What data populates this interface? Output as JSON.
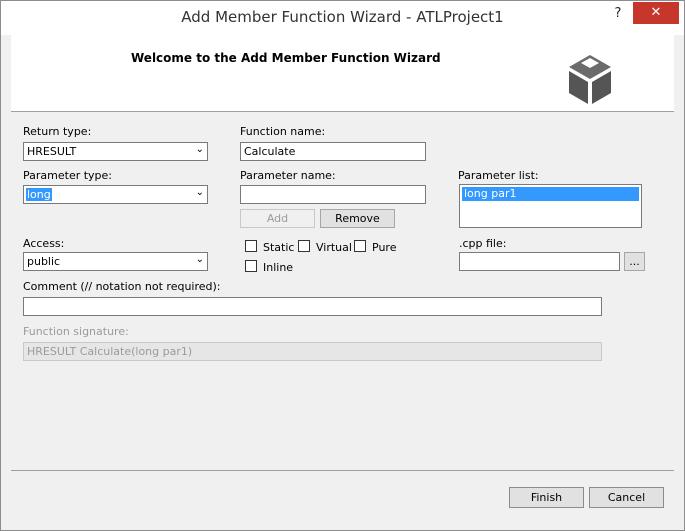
{
  "window": {
    "title": "Add Member Function Wizard - ATLProject1",
    "help": "?",
    "close": "✕"
  },
  "header": {
    "title": "Welcome to the Add Member Function Wizard"
  },
  "form": {
    "return_type": {
      "label": "Return type:",
      "value": "HRESULT"
    },
    "function_name": {
      "label": "Function name:",
      "value": "Calculate"
    },
    "parameter_type": {
      "label": "Parameter type:",
      "value": "long"
    },
    "parameter_name": {
      "label": "Parameter name:",
      "value": ""
    },
    "parameter_list": {
      "label": "Parameter list:",
      "items": [
        "long par1"
      ]
    },
    "add_label": "Add",
    "remove_label": "Remove",
    "access": {
      "label": "Access:",
      "value": "public"
    },
    "options": {
      "static": "Static",
      "virtual": "Virtual",
      "pure": "Pure",
      "inline": "Inline"
    },
    "cpp_file": {
      "label": ".cpp file:",
      "value": "",
      "browse": "..."
    },
    "comment": {
      "label": "Comment (// notation not required):",
      "value": ""
    },
    "signature": {
      "label": "Function signature:",
      "value": "HRESULT Calculate(long par1)"
    }
  },
  "footer": {
    "finish": "Finish",
    "cancel": "Cancel"
  },
  "icons": {
    "combo_arrow": "⌄"
  }
}
